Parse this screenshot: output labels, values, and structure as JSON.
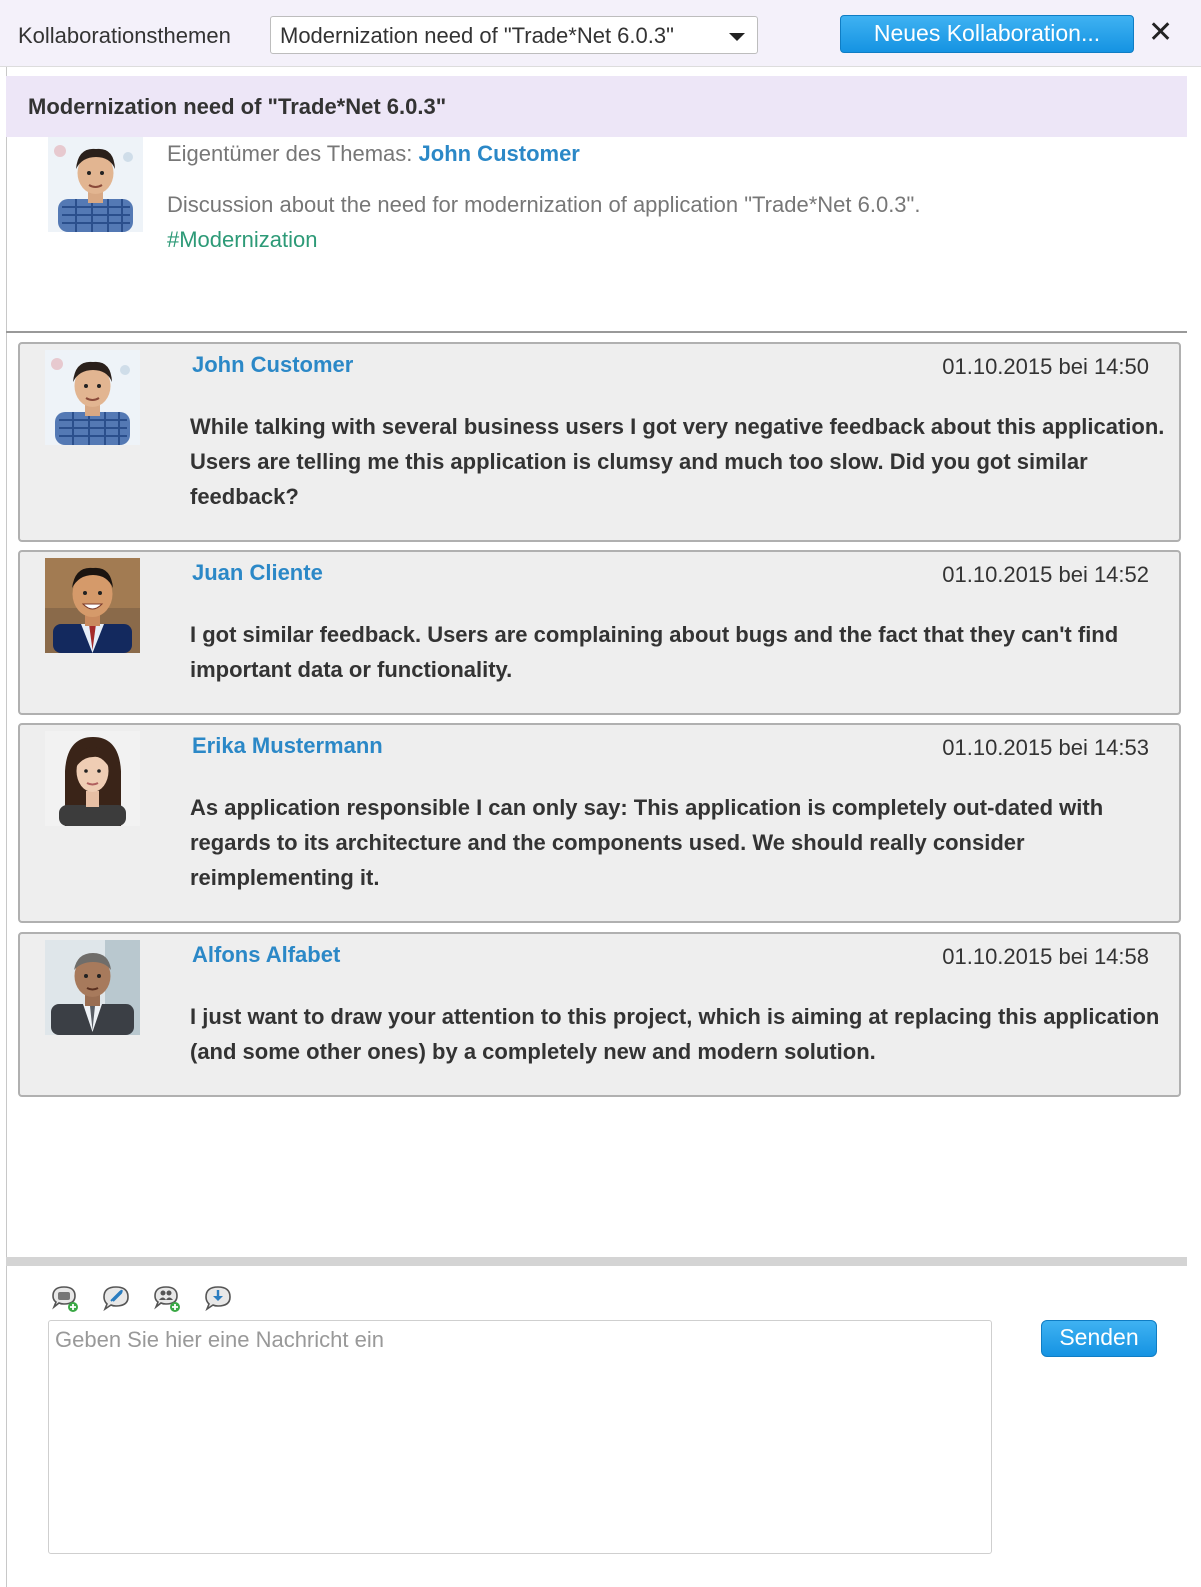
{
  "toolbar": {
    "label": "Kollaborationsthemen",
    "selected_topic": "Modernization need of \"Trade*Net 6.0.3\"",
    "new_button": "Neues Kollaboration...",
    "close_glyph": "✕"
  },
  "topic": {
    "title": "Modernization need of \"Trade*Net 6.0.3\"",
    "owner_label": "Eigentümer des Themas:",
    "owner_name": "John Customer",
    "description": "Discussion about the need for modernization of application \"Trade*Net 6.0.3\".",
    "tag": "#Modernization"
  },
  "messages": [
    {
      "author": "John Customer",
      "time": "01.10.2015 bei 14:50",
      "text": "While talking with several business users I got very negative feedback about this application. Users are telling me this application is clumsy and much too slow. Did you got similar feedback?"
    },
    {
      "author": "Juan Cliente",
      "time": "01.10.2015 bei 14:52",
      "text": "I got similar feedback. Users are complaining about bugs and the fact that they can't find important data or functionality."
    },
    {
      "author": "Erika Mustermann",
      "time": "01.10.2015 bei 14:53",
      "text": "As application responsible I can only say: This application is completely out-dated with regards to its architecture and the components used. We should really consider reimplementing it."
    },
    {
      "author": "Alfons Alfabet",
      "time": "01.10.2015 bei 14:58",
      "text": "I just want to draw your attention to this project, which is aiming at replacing this application (and some other ones) by a completely new and modern solution."
    }
  ],
  "composer": {
    "icons": [
      "add-comment-icon",
      "attach-icon",
      "add-participant-icon",
      "download-icon"
    ],
    "placeholder": "Geben Sie hier eine Nachricht ein",
    "send_label": "Senden"
  },
  "colors": {
    "accent": "#1a9be6",
    "link": "#2b88c7",
    "tag": "#2d9a77",
    "header_bg": "#ede6f7"
  }
}
